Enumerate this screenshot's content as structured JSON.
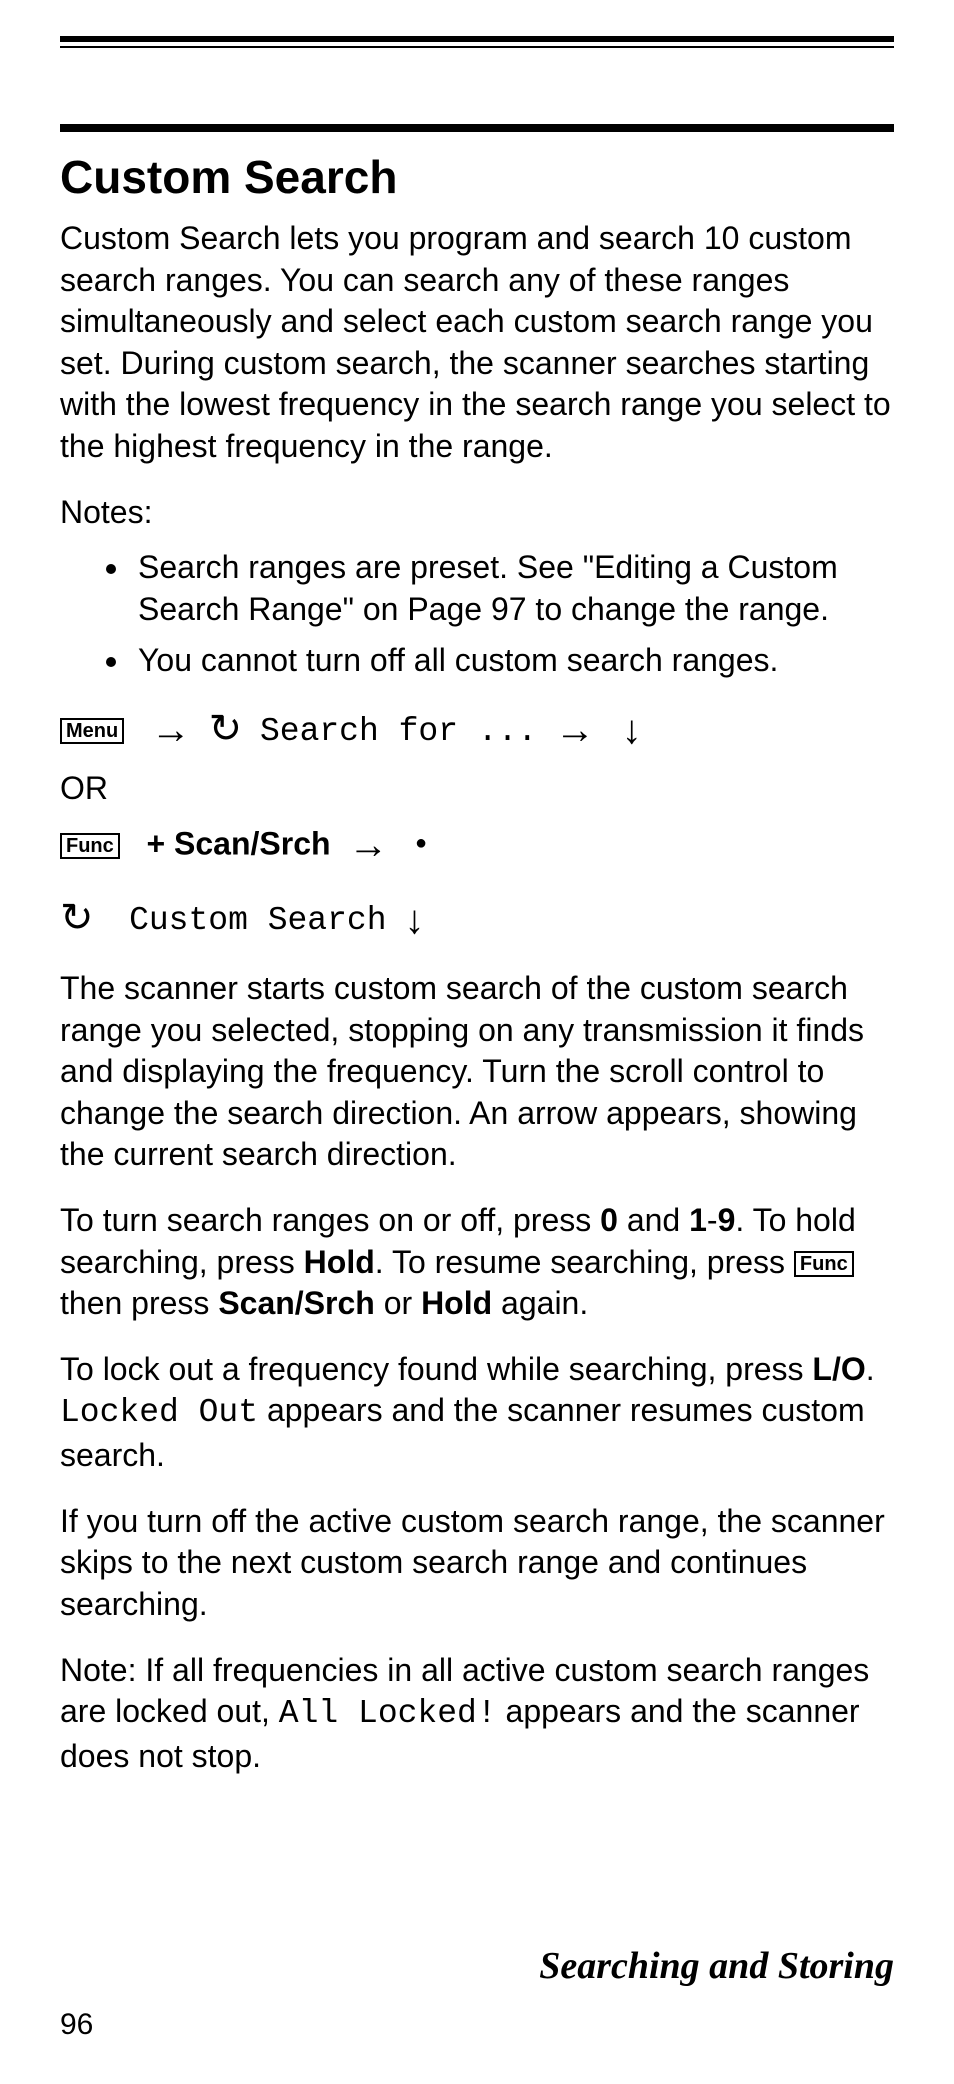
{
  "heading": "Custom Search",
  "intro": "Custom Search lets you program and search 10 custom search ranges. You can search any of these ranges simultaneously and select each custom search range you set. During custom search, the scanner searches starting with the lowest frequency in the search range you select to the highest frequency in the range.",
  "notes_label": "Notes:",
  "bullets": [
    "Search ranges are preset. See \"Editing a Custom Search Range\" on Page 97 to change the range.",
    "You cannot turn off all custom search ranges."
  ],
  "keys": {
    "menu": "Menu",
    "func": "Func"
  },
  "seq1_search_for": "Search for ...",
  "or_label": "OR",
  "scan_srch_label": "Scan/Srch",
  "custom_search_mono": "Custom Search",
  "para2": "The scanner starts custom search of the custom search range you selected, stopping on any transmission it finds and displaying the frequency. Turn the scroll control to change the search direction. An arrow appears, showing the current search direction.",
  "para3": {
    "a": "To turn search ranges on or off, press ",
    "zero": "0",
    "b": " and ",
    "one": "1",
    "dash": "-",
    "nine": "9",
    "c": ". To hold searching, press ",
    "hold": "Hold",
    "d": ". To resume searching, press ",
    "e": " then press ",
    "scan": "Scan/Srch",
    "f": " or ",
    "hold2": "Hold",
    "g": " again."
  },
  "para4": {
    "a": "To lock out a frequency found while searching, press ",
    "lo": "L/O",
    "b": ". ",
    "locked_out": "Locked Out",
    "c": " appears and the scanner resumes custom search."
  },
  "para5": "If you turn off the active custom search range, the scanner skips to the next custom search range and continues searching.",
  "para6": {
    "a": "Note: If all frequencies in all active custom search ranges are locked out, ",
    "all_locked": "All Locked!",
    "b": " appears and the scanner does not stop."
  },
  "footer_title": "Searching and Storing",
  "page_number": "96"
}
